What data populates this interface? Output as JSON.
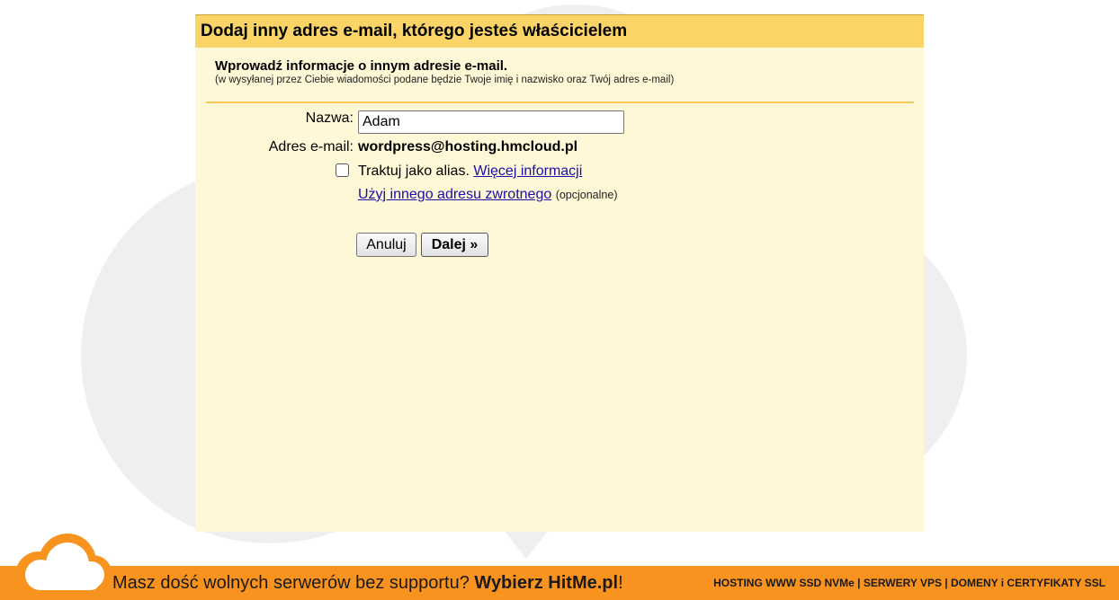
{
  "dialog": {
    "title": "Dodaj inny adres e-mail, którego jesteś właścicielem",
    "intro_heading": "Wprowadź informacje o innym adresie e-mail.",
    "intro_sub": "(w wysyłanej przez Ciebie wiadomości podane będzie Twoje imię i nazwisko oraz Twój adres e-mail)",
    "name_label": "Nazwa:",
    "name_value": "Adam",
    "email_label": "Adres e-mail:",
    "email_value": "wordpress@hosting.hmcloud.pl",
    "alias_checked": false,
    "alias_text": "Traktuj jako alias.",
    "alias_link": "Więcej informacji",
    "return_link": "Użyj innego adresu zwrotnego",
    "return_optional": "(opcjonalne)",
    "cancel_label": "Anuluj",
    "next_label": "Dalej »"
  },
  "banner": {
    "text_prefix": "Masz dość wolnych serwerów bez supportu?",
    "text_bold": "Wybierz HitMe.pl",
    "text_suffix": "!",
    "services": "HOSTING WWW SSD NVMe | SERWERY VPS | DOMENY i CERTYFIKATY SSL"
  },
  "colors": {
    "header": "#fad466",
    "dialog_bg": "#fff8d6",
    "divider": "#f6c85a",
    "banner": "#f7931e",
    "link": "#1a0dab"
  }
}
